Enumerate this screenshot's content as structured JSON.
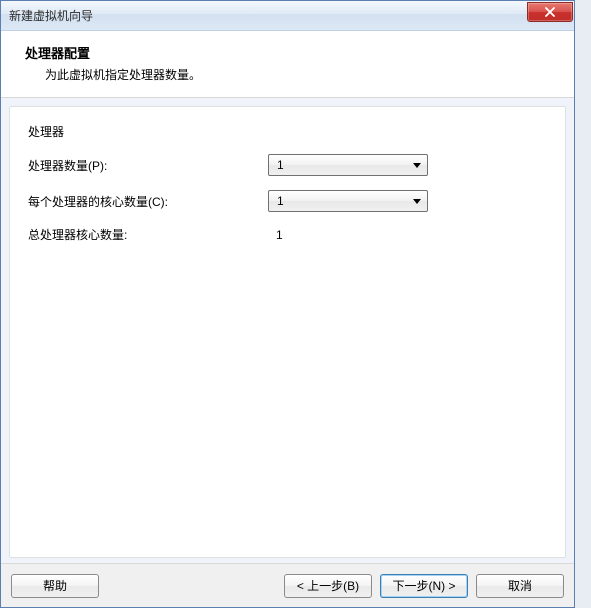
{
  "titlebar": {
    "title": "新建虚拟机向导"
  },
  "header": {
    "title": "处理器配置",
    "subtitle": "为此虚拟机指定处理器数量。"
  },
  "form": {
    "group_label": "处理器",
    "cpu_count_label": "处理器数量(P):",
    "cpu_count_value": "1",
    "cores_label": "每个处理器的核心数量(C):",
    "cores_value": "1",
    "total_label": "总处理器核心数量:",
    "total_value": "1"
  },
  "footer": {
    "help": "帮助",
    "back": "< 上一步(B)",
    "next": "下一步(N) >",
    "cancel": "取消"
  }
}
